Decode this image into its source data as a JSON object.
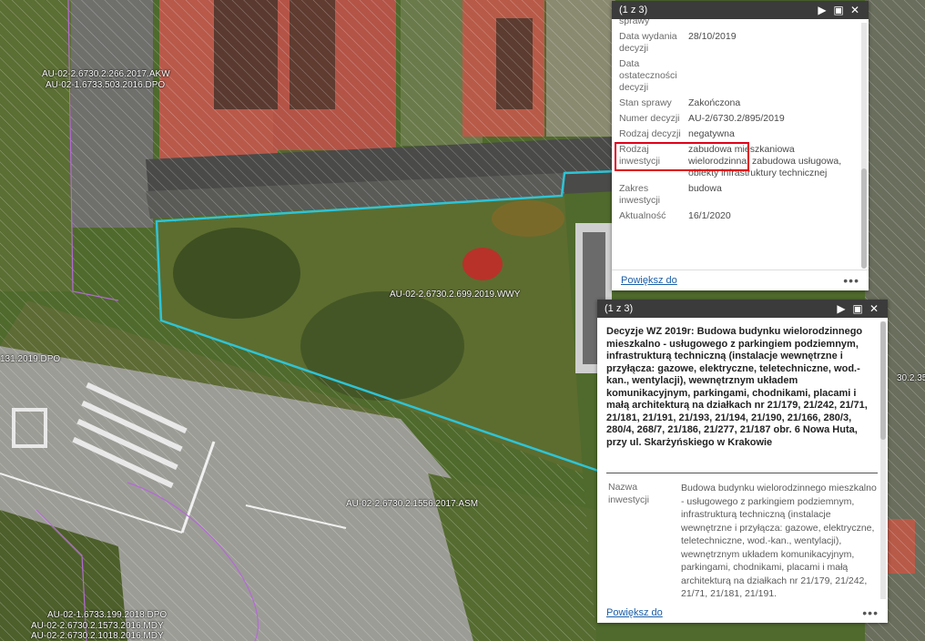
{
  "colors": {
    "parcel_outline": "#2ec4d6",
    "highlight": "#e0001a",
    "popup_header": "#3b3b3b",
    "link": "#1a5ea8"
  },
  "map": {
    "labels": [
      "AU-02-2.6730.2.266.2017.AKW",
      "AU-02-1.6733.503.2016.DPO",
      "AU-02-2.6730.2.699.2019.WWY",
      "131.2019.DPO",
      "AU-02-2.6730.2.1556.2017.ASM",
      "30.2.35",
      "AU-02-1.6733.199.2018.DPO",
      "AU-02-2.6730.2.1573.2016.MDY",
      "AU-02-2.6730.2.1018.2016.MDY"
    ]
  },
  "popup1": {
    "counter": "(1 z 3)",
    "icons": {
      "next": "play-icon",
      "maximize": "maximize-icon",
      "close": "close-icon"
    },
    "rows": [
      {
        "key": "sprawy",
        "value": ""
      },
      {
        "key": "Data wydania decyzji",
        "value": "28/10/2019"
      },
      {
        "key": "Data ostateczności decyzji",
        "value": ""
      },
      {
        "key": "Stan sprawy",
        "value": "Zakończona"
      },
      {
        "key": "Numer decyzji",
        "value": "AU-2/6730.2/895/2019"
      },
      {
        "key": "Rodzaj decyzji",
        "value": "negatywna"
      },
      {
        "key": "Rodzaj inwestycji",
        "value": "zabudowa mieszkaniowa wielorodzinna, zabudowa usługowa, obiekty infrastruktury technicznej"
      },
      {
        "key": "Zakres inwestycji",
        "value": "budowa"
      },
      {
        "key": "Aktualność",
        "value": "16/1/2020"
      }
    ],
    "zoom_link": "Powiększ do",
    "more": "•••"
  },
  "popup2": {
    "counter": "(1 z 3)",
    "title": "Decyzje WZ 2019r: Budowa budynku wielorodzinnego mieszkalno - usługowego z parkingiem podziemnym, infrastrukturą techniczną (instalacje wewnętrzne i przyłącza: gazowe, elektryczne, teletechniczne, wod.-kan., wentylacji), wewnętrznym układem komunikacyjnym, parkingami, chodnikami, placami i małą architekturą na działkach nr 21/179, 21/242, 21/71, 21/181, 21/191, 21/193, 21/194, 21/190, 21/166, 280/3, 280/4, 268/7, 21/186, 21/277, 21/187 obr. 6 Nowa Huta, przy ul. Skarżyńskiego w Krakowie",
    "row_key": "Nazwa inwestycji",
    "row_value": "Budowa budynku wielorodzinnego mieszkalno - usługowego z parkingiem podziemnym, infrastrukturą techniczną (instalacje wewnętrzne i przyłącza: gazowe, elektryczne, teletechniczne, wod.-kan., wentylacji), wewnętrznym układem komunikacyjnym, parkingami, chodnikami, placami i małą architekturą na działkach nr 21/179, 21/242, 21/71, 21/181, 21/191.",
    "zoom_link": "Powiększ do",
    "more": "•••"
  }
}
